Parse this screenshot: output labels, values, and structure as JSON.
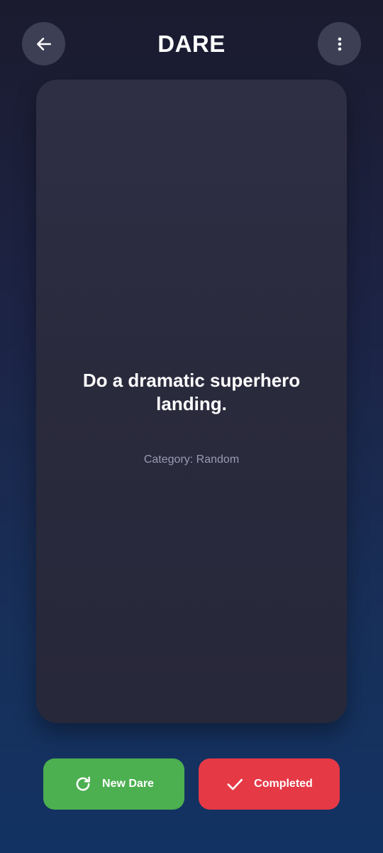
{
  "header": {
    "title": "DARE",
    "back_icon": "arrow-left-icon",
    "menu_icon": "more-vertical-icon"
  },
  "card": {
    "dare_text": "Do a dramatic superhero landing.",
    "category_label": "Category:",
    "category_value": "Random"
  },
  "actions": {
    "new_dare_label": "New Dare",
    "new_dare_icon": "refresh-icon",
    "completed_label": "Completed",
    "completed_icon": "check-icon"
  },
  "colors": {
    "new_dare": "#4caf50",
    "completed": "#e53946",
    "card": "#2a2a3d",
    "icon_button": "#3d3f55"
  }
}
